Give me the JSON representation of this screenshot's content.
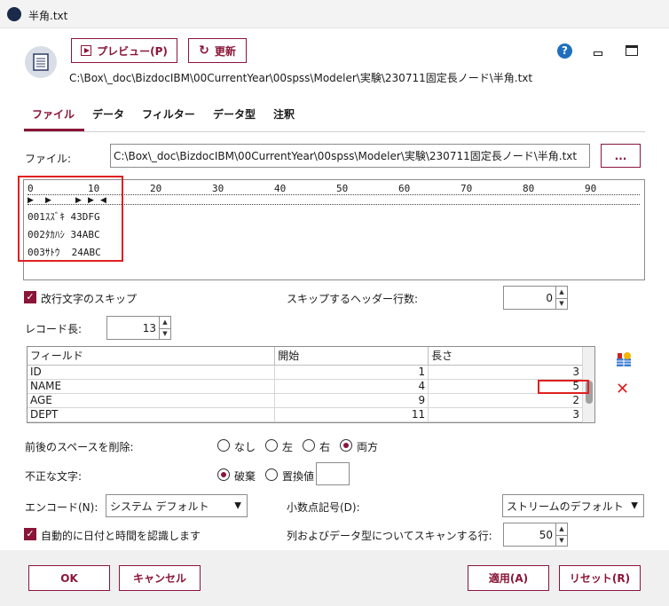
{
  "window": {
    "title": "半角.txt"
  },
  "toolbar": {
    "preview_label": "プレビュー(P)",
    "refresh_label": "更新"
  },
  "header": {
    "path": "C:\\Box\\_doc\\BizdocIBM\\00CurrentYear\\00spss\\Modeler\\実験\\230711固定長ノード\\半角.txt"
  },
  "tabs": [
    {
      "label": "ファイル"
    },
    {
      "label": "データ"
    },
    {
      "label": "フィルター"
    },
    {
      "label": "データ型"
    },
    {
      "label": "注釈"
    }
  ],
  "file": {
    "label": "ファイル:",
    "value": "C:\\Box\\_doc\\BizdocIBM\\00CurrentYear\\00spss\\Modeler\\実験\\230711固定長ノード\\半角.txt",
    "browse_label": "..."
  },
  "ruler": {
    "ticks": [
      "0",
      "10",
      "20",
      "30",
      "40",
      "50",
      "60",
      "70",
      "80",
      "90"
    ]
  },
  "preview_lines": [
    "001ｽｽﾞｷ 43DFG",
    "002ﾀｶﾊｼ 34ABC",
    "003ｻﾄｳ  24ABC"
  ],
  "options": {
    "skip_newline_label": "改行文字のスキップ",
    "skip_header_label": "スキップするヘッダー行数:",
    "skip_header_value": "0",
    "record_length_label": "レコード長:",
    "record_length_value": "13"
  },
  "fields_table": {
    "columns": [
      "フィールド",
      "開始",
      "長さ"
    ],
    "rows": [
      {
        "field": "ID",
        "start": "1",
        "length": "3"
      },
      {
        "field": "NAME",
        "start": "4",
        "length": "5"
      },
      {
        "field": "AGE",
        "start": "9",
        "length": "2"
      },
      {
        "field": "DEPT",
        "start": "11",
        "length": "3"
      }
    ]
  },
  "trim": {
    "label": "前後のスペースを削除:",
    "options": [
      "なし",
      "左",
      "右",
      "両方"
    ],
    "selected": "両方"
  },
  "invalid": {
    "label": "不正な文字:",
    "options": [
      "破棄",
      "置換値"
    ],
    "selected": "破棄"
  },
  "encoding": {
    "label": "エンコード(N):",
    "value": "システム デフォルト"
  },
  "decimal": {
    "label": "小数点記号(D):",
    "value": "ストリームのデフォルト"
  },
  "auto_date": {
    "label": "自動的に日付と時間を認識します"
  },
  "scan_rows": {
    "label": "列およびデータ型についてスキャンする行:",
    "value": "50"
  },
  "footer": {
    "ok_label": "OK",
    "cancel_label": "キャンセル",
    "apply_label": "適用(A)",
    "reset_label": "リセット(R)"
  },
  "colors": {
    "accent": "#8a1538",
    "highlight": "#e02020",
    "help": "#1f6fbf"
  }
}
